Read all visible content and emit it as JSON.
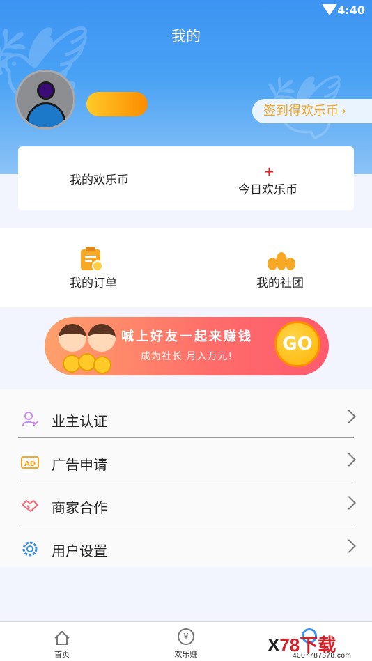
{
  "status_bar": {
    "time": "4:40"
  },
  "header": {
    "title": "我的",
    "sign_in_label": "签到得欢乐币",
    "sign_in_chevron": "›"
  },
  "coins": {
    "my_coins_label": "我的欢乐币",
    "today_coins_label": "今日欢乐币",
    "today_coins_value": "+"
  },
  "quick_actions": {
    "orders_label": "我的订单",
    "clubs_label": "我的社团"
  },
  "banner": {
    "headline": "喊上好友一起来赚钱",
    "subline": "成为社长  月入万元!",
    "go_label": "GO"
  },
  "menu": {
    "items": [
      {
        "label": "业主认证",
        "icon": "owner-verify-icon"
      },
      {
        "label": "广告申请",
        "icon": "ad-icon"
      },
      {
        "label": "商家合作",
        "icon": "handshake-icon"
      },
      {
        "label": "用户设置",
        "icon": "gear-icon"
      }
    ]
  },
  "bottom_nav": {
    "tabs": [
      {
        "label": "首页",
        "icon": "home-icon"
      },
      {
        "label": "欢乐赚",
        "icon": "yen-icon"
      }
    ],
    "yen_symbol": "¥"
  },
  "watermark": {
    "brand": "78下载",
    "prefix": "X",
    "url": "4007787878.com"
  },
  "colors": {
    "header_blue": "#3d94f3",
    "accent_orange": "#f5a623",
    "plus_red": "#e02020"
  }
}
